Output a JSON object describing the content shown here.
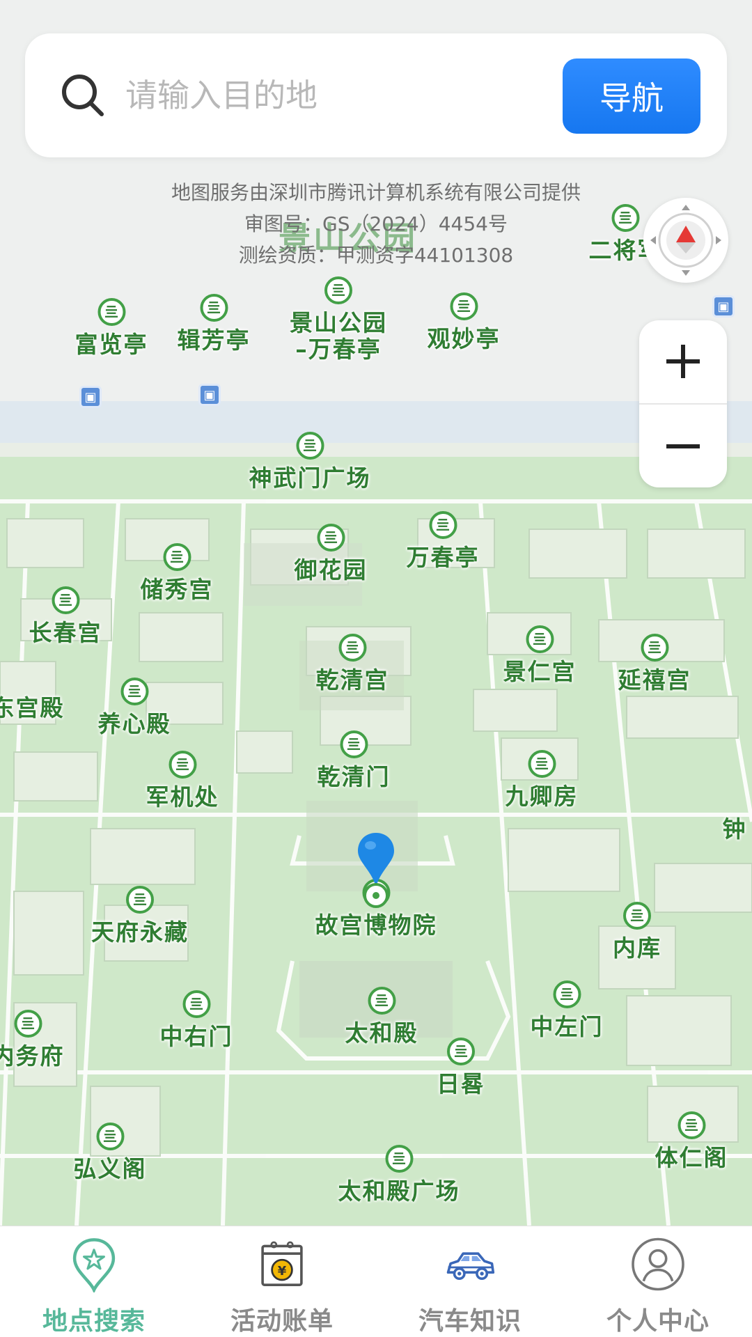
{
  "search": {
    "placeholder": "请输入目的地",
    "value": "",
    "nav_label": "导航"
  },
  "attribution": [
    "地图服务由深圳市腾讯计算机系统有限公司提供",
    "审图号：GS（2024）4454号",
    "测绘资质：甲测资字44101308"
  ],
  "map": {
    "area_label": "景山公园",
    "pois": [
      {
        "name": "富览亭"
      },
      {
        "name": "辑芳亭"
      },
      {
        "name": "景山公园\n–万春亭"
      },
      {
        "name": "观妙亭"
      },
      {
        "name": "二将军"
      },
      {
        "name": "神武门广场"
      },
      {
        "name": "御花园"
      },
      {
        "name": "万春亭"
      },
      {
        "name": "储秀宫"
      },
      {
        "name": "长春宫"
      },
      {
        "name": "乾清宫"
      },
      {
        "name": "景仁宫"
      },
      {
        "name": "延禧宫"
      },
      {
        "name": "东宫殿"
      },
      {
        "name": "养心殿"
      },
      {
        "name": "乾清门"
      },
      {
        "name": "九卿房"
      },
      {
        "name": "军机处"
      },
      {
        "name": "钟"
      },
      {
        "name": "故宫博物院"
      },
      {
        "name": "天府永藏"
      },
      {
        "name": "内库"
      },
      {
        "name": "中右门"
      },
      {
        "name": "太和殿"
      },
      {
        "name": "中左门"
      },
      {
        "name": "日晷"
      },
      {
        "name": "内务府"
      },
      {
        "name": "弘义阁"
      },
      {
        "name": "太和殿广场"
      },
      {
        "name": "体仁阁"
      }
    ],
    "poi_icon_glyph": "亖",
    "bus_icon_glyph": "▣"
  },
  "tabs": [
    {
      "label": "地点搜索",
      "icon": "location-star-icon",
      "active": true
    },
    {
      "label": "活动账单",
      "icon": "calendar-yuan-icon",
      "active": false
    },
    {
      "label": "汽车知识",
      "icon": "car-icon",
      "active": false
    },
    {
      "label": "个人中心",
      "icon": "user-icon",
      "active": false
    }
  ],
  "colors": {
    "accent": "#1677f0",
    "active_tab": "#57b89a",
    "poi_green": "#2f7d32",
    "pin_blue": "#1e88e5"
  }
}
